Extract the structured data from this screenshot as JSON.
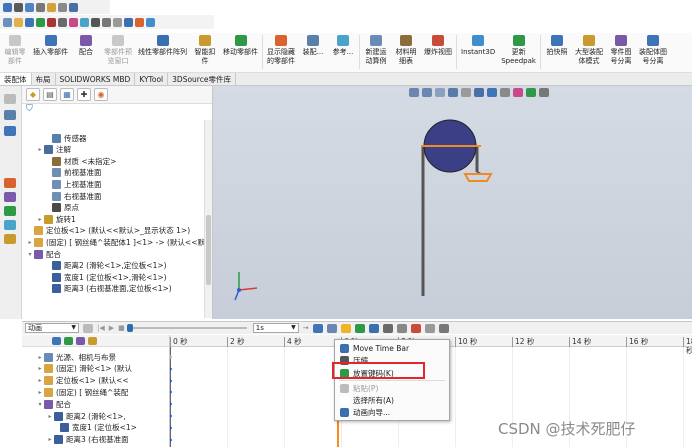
{
  "ribbon": {
    "buttons": [
      {
        "label": "编辑零\n部件",
        "disabled": true
      },
      {
        "label": "插入零部件",
        "disabled": false
      },
      {
        "label": "配合",
        "disabled": false
      },
      {
        "label": "零部件预\n览窗口",
        "disabled": true
      },
      {
        "label": "线性零部件阵列",
        "disabled": false
      },
      {
        "label": "智能扣\n件",
        "disabled": false
      },
      {
        "label": "移动零部件",
        "disabled": false
      },
      {
        "label": "显示隐藏\n的零部件",
        "disabled": false
      },
      {
        "label": "装配...",
        "disabled": false
      },
      {
        "label": "参考...",
        "disabled": false
      },
      {
        "label": "新建运\n动算例",
        "disabled": false
      },
      {
        "label": "材料明\n细表",
        "disabled": false
      },
      {
        "label": "爆炸视图",
        "disabled": false
      },
      {
        "label": "Instant3D",
        "disabled": false
      },
      {
        "label": "更新\nSpeedpak",
        "disabled": false
      },
      {
        "label": "拍快照",
        "disabled": false
      },
      {
        "label": "大型装配\n体模式",
        "disabled": false
      },
      {
        "label": "零件图\n号分离",
        "disabled": false
      },
      {
        "label": "装配体图\n号分离",
        "disabled": false
      }
    ]
  },
  "tabs": [
    "装配体",
    "布局",
    "SOLIDWORKS MBD",
    "KYTool",
    "3DSource零件库"
  ],
  "tree": {
    "items": [
      {
        "label": "传感器",
        "indent": 18,
        "expand": "",
        "color": "#5a7fa8"
      },
      {
        "label": "注解",
        "indent": 10,
        "expand": "▸",
        "color": "#4a6c9b"
      },
      {
        "label": "材质 <未指定>",
        "indent": 18,
        "expand": "",
        "color": "#8a6d3b"
      },
      {
        "label": "前视基准面",
        "indent": 18,
        "expand": "",
        "color": "#6f8fb5"
      },
      {
        "label": "上视基准面",
        "indent": 18,
        "expand": "",
        "color": "#6f8fb5"
      },
      {
        "label": "右视基准面",
        "indent": 18,
        "expand": "",
        "color": "#6f8fb5"
      },
      {
        "label": "原点",
        "indent": 18,
        "expand": "",
        "color": "#4a4a4a"
      },
      {
        "label": "旋转1",
        "indent": 10,
        "expand": "▸",
        "color": "#c99a2e"
      },
      {
        "label": "定位板<1> (默认<<默认>_显示状态 1>)",
        "indent": 0,
        "expand": "",
        "color": "#d9a441"
      },
      {
        "label": "(固定) [ 钢丝绳^装配体1 ]<1> -> (默认<<默认",
        "indent": 0,
        "expand": "▸",
        "color": "#d9a441"
      },
      {
        "label": "配合",
        "indent": 0,
        "expand": "▾",
        "color": "#7a5aa8"
      },
      {
        "label": "距离2 (滑轮<1>,定位板<1>)",
        "indent": 18,
        "expand": "",
        "color": "#3a5f9a"
      },
      {
        "label": "宽度1 (定位板<1>,滑轮<1>)",
        "indent": 18,
        "expand": "",
        "color": "#3a5f9a"
      },
      {
        "label": "距离3 (右视基准面,定位板<1>)",
        "indent": 18,
        "expand": "",
        "color": "#3a5f9a"
      }
    ]
  },
  "motion": {
    "study_type": "动画",
    "time_value": "1s"
  },
  "timeline": {
    "rows": [
      {
        "label": "光源、相机与布景",
        "indent": 14,
        "expand": "▸",
        "color": "#6a8ab8"
      },
      {
        "label": "(固定) 滑轮<1> (默认",
        "indent": 14,
        "expand": "▸",
        "color": "#d9a441"
      },
      {
        "label": "定位板<1> (默认<<",
        "indent": 14,
        "expand": "▸",
        "color": "#d9a441"
      },
      {
        "label": "(固定) [ 钢丝绳^装配",
        "indent": 14,
        "expand": "▸",
        "color": "#d9a441"
      },
      {
        "label": "配合",
        "indent": 14,
        "expand": "▾",
        "color": "#7a5aa8"
      },
      {
        "label": "距离2 (滑轮<1>,",
        "indent": 24,
        "expand": "▸",
        "color": "#3a5f9a"
      },
      {
        "label": "宽度1 (定位板<1>",
        "indent": 30,
        "expand": "",
        "color": "#3a5f9a"
      },
      {
        "label": "距离3 (右视基准面",
        "indent": 24,
        "expand": "▸",
        "color": "#3a5f9a"
      }
    ],
    "ruler": [
      "0 秒",
      "2 秒",
      "4 秒",
      "6 秒",
      "8 秒",
      "10 秒",
      "12 秒",
      "14 秒",
      "16 秒",
      "18 秒"
    ]
  },
  "context_menu": {
    "items": [
      {
        "label": "Move Time Bar",
        "disabled": false,
        "color": "#3a6fb0"
      },
      {
        "label": "压缩",
        "disabled": false,
        "color": "#555"
      },
      {
        "label": "放置键码(K)",
        "disabled": false,
        "color": "#2e9a48"
      },
      {
        "label": "粘贴(P)",
        "disabled": true,
        "color": "#bbb"
      },
      {
        "label": "选择所有(A)",
        "disabled": false,
        "color": "#ffffff"
      },
      {
        "label": "动画向导...",
        "disabled": false,
        "color": "#3a6fb0"
      }
    ]
  },
  "watermark": "CSDN @技术死肥仔"
}
